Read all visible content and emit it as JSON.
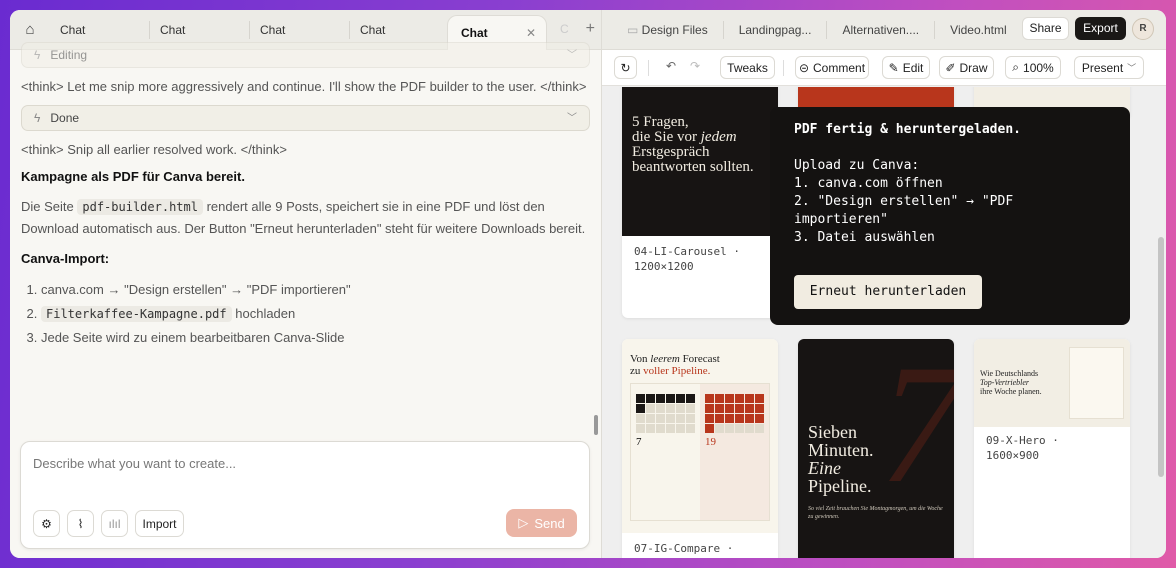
{
  "left_tabs": {
    "items": [
      "Chat",
      "Chat",
      "Chat",
      "Chat"
    ],
    "active": "Chat",
    "ghost": "C"
  },
  "chat": {
    "editing_label": "Editing",
    "think1": "<think> Let me snip more aggressively and continue. I'll show the PDF builder to the user. </think>",
    "done_label": "Done",
    "think2": "<think> Snip all earlier resolved work. </think>",
    "heading": "Kampagne als PDF für Canva bereit.",
    "para_pre": "Die Seite",
    "para_code": "pdf-builder.html",
    "para_post": "rendert alle 9 Posts, speichert sie in eine PDF und löst den Download automatisch aus. Der Button \"Erneut herunterladen\" steht für weitere Downloads bereit.",
    "import_heading": "Canva-Import:",
    "step1": "canva.com → \"Design erstellen\" → \"PDF importieren\"",
    "step2_code": "Filterkaffee-Kampagne.pdf",
    "step2_post": "hochladen",
    "step3": "Jede Seite wird zu einem bearbeitbaren Canva-Slide"
  },
  "composer": {
    "placeholder": "Describe what you want to create...",
    "import_label": "Import",
    "send_label": "Send"
  },
  "right_tabs": {
    "items": [
      "Design Files",
      "Landingpag...",
      "Alternativen....",
      "Video.html"
    ],
    "share": "Share",
    "export": "Export",
    "avatar": "R"
  },
  "toolbar": {
    "tweaks": "Tweaks",
    "comment": "Comment",
    "edit": "Edit",
    "draw": "Draw",
    "zoom": "100%",
    "present": "Present"
  },
  "cards": {
    "c1": {
      "headline1": "5 Fragen,",
      "headline2a": "die Sie vor ",
      "headline2b": "jedem",
      "headline3": "Erstgespräch",
      "headline4": "beantworten sollten.",
      "label": "04-LI-Carousel · 1200×1200"
    },
    "c4": {
      "line1a": "Von ",
      "line1b": "leerem",
      "line1c": " Forecast",
      "line2a": "zu ",
      "line2b": "voller Pipeline.",
      "n1": "7",
      "n2": "19",
      "label": "07-IG-Compare ·"
    },
    "c5": {
      "l1": "Sieben",
      "l2": "Minuten.",
      "l3": "Eine",
      "l4": "Pipeline.",
      "big": "7",
      "sub": "So viel Zeit brauchen Sie Montagmorgen, um die Woche zu gewinnen."
    },
    "c6": {
      "l1": "Wie Deutschlands",
      "l2": "Top-Vertriebler",
      "l3": "ihre Woche planen.",
      "label": "09-X-Hero · 1600×900"
    }
  },
  "toast": {
    "title": "PDF fertig & heruntergeladen.",
    "upload": "Upload zu Canva:",
    "s1": "1. canva.com öffnen",
    "s2": "2. \"Design erstellen\" → \"PDF importieren\"",
    "s3": "3. Datei auswählen",
    "button": "Erneut herunterladen"
  },
  "colors": {
    "accent": "#b8361c",
    "send": "#ebb5a6",
    "dark": "#141211"
  }
}
